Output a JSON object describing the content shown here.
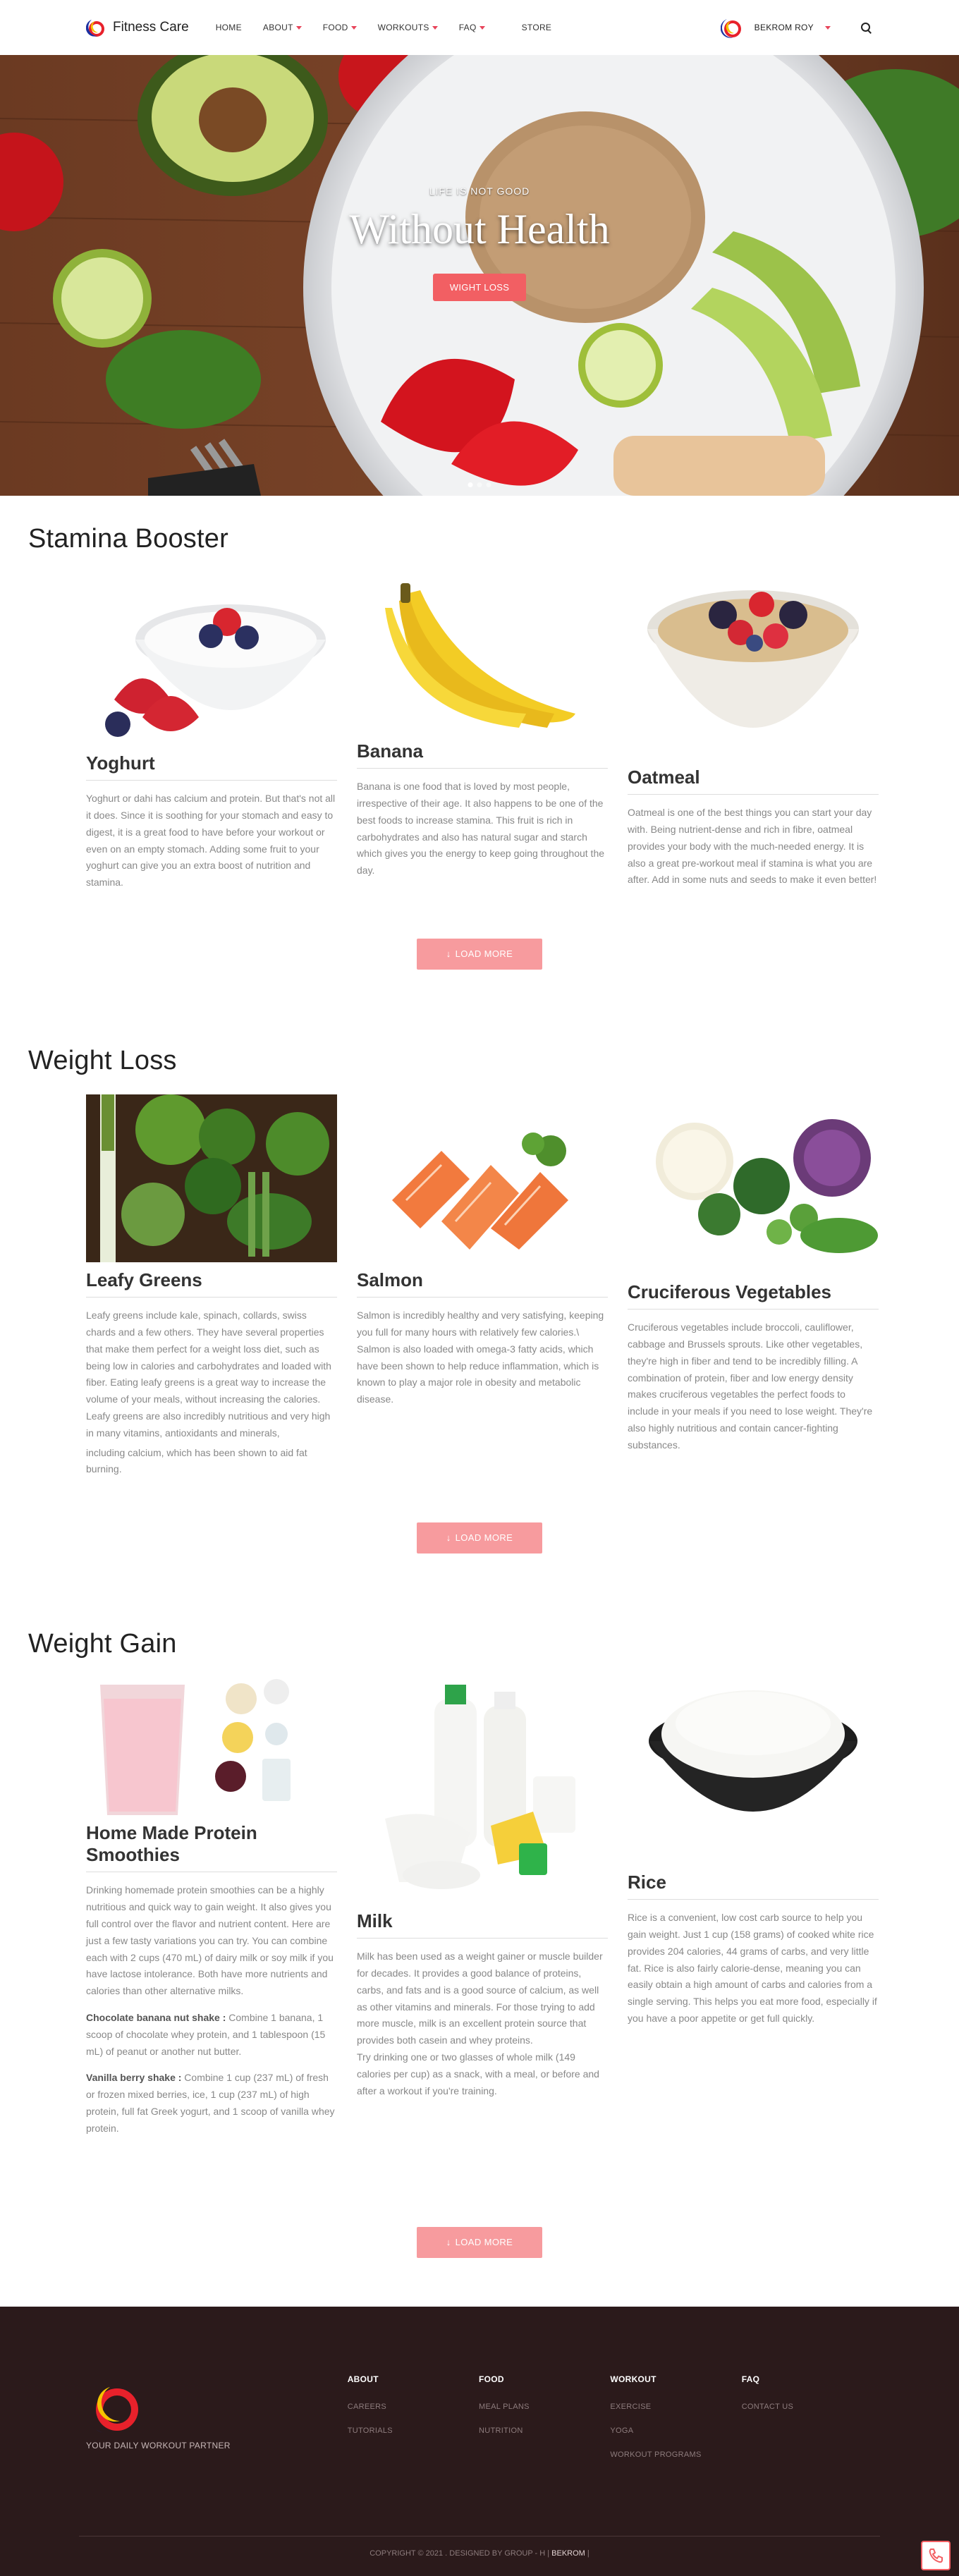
{
  "nav": {
    "brand": "Fitness Care",
    "items": [
      {
        "label": "HOME",
        "caret": false
      },
      {
        "label": "ABOUT",
        "caret": true
      },
      {
        "label": "FOOD",
        "caret": true
      },
      {
        "label": "WORKOUTS",
        "caret": true
      },
      {
        "label": "FAQ",
        "caret": true
      },
      {
        "label": "STORE",
        "caret": false
      }
    ],
    "user": "BEKROM ROY",
    "icons": {
      "search": "search-icon",
      "user": "user-avatar-icon"
    }
  },
  "hero": {
    "kicker": "LIFE IS NOT GOOD",
    "title": "Without Health",
    "button": "WIGHT LOSS"
  },
  "sections": {
    "stamina": {
      "title": "Stamina Booster",
      "load_more": "LOAD MORE",
      "cards": [
        {
          "title": "Yoghurt",
          "text": "Yoghurt or dahi has calcium and protein. But that's not all it does. Since it is soothing for your stomach and easy to digest, it is a great food to have before your workout or even on an empty stomach. Adding some fruit to your yoghurt can give you an extra boost of nutrition and stamina."
        },
        {
          "title": "Banana",
          "text": "Banana is one food that is loved by most people, irrespective of their age. It also happens to be one of the best foods to increase stamina. This fruit is rich in carbohydrates and also has natural sugar and starch which gives you the energy to keep going throughout the day."
        },
        {
          "title": "Oatmeal",
          "text": "Oatmeal is one of the best things you can start your day with. Being nutrient-dense and rich in fibre, oatmeal provides your body with the much-needed energy. It is also a great pre-workout meal if stamina is what you are after. Add in some nuts and seeds to make it even better!"
        }
      ]
    },
    "weight_loss": {
      "title": "Weight Loss",
      "load_more": "LOAD MORE",
      "cards": [
        {
          "title": "Leafy Greens",
          "text": "Leafy greens include kale, spinach, collards, swiss chards and a few others. They have several properties that make them perfect for a weight loss diet, such as being low in calories and carbohydrates and loaded with fiber. Eating leafy greens is a great way to increase the volume of your meals, without increasing the calories. Leafy greens are also incredibly nutritious and very high in many vitamins, antioxidants and minerals,",
          "text2": "including calcium, which has been shown to aid fat burning."
        },
        {
          "title": "Salmon",
          "text": "Salmon is incredibly healthy and very satisfying, keeping you full for many hours with relatively few calories.\\ Salmon is also loaded with omega-3 fatty acids, which have been shown to help reduce inflammation, which is known to play a major role in obesity and metabolic disease."
        },
        {
          "title": "Cruciferous Vegetables",
          "text": "Cruciferous vegetables include broccoli, cauliflower, cabbage and Brussels sprouts. Like other vegetables, they're high in fiber and tend to be incredibly filling. A combination of protein, fiber and low energy density makes cruciferous vegetables the perfect foods to include in your meals if you need to lose weight. They're also highly nutritious and contain cancer-fighting substances."
        }
      ]
    },
    "weight_gain": {
      "title": "Weight Gain",
      "load_more": "LOAD MORE",
      "cards": [
        {
          "title": "Home Made Protein Smoothies",
          "text": "Drinking homemade protein smoothies can be a highly nutritious and quick way to gain weight. It also gives you full control over the flavor and nutrient content. Here are just a few tasty variations you can try. You can combine each with 2 cups (470 mL) of dairy milk or soy milk if you have lactose intolerance. Both have more nutrients and calories than other alternative milks.",
          "recipe1_name": "Chocolate banana nut shake :",
          "recipe1_text": " Combine 1 banana, 1 scoop of chocolate whey protein, and 1 tablespoon (15 mL) of peanut or another nut butter.",
          "recipe2_name": "Vanilla berry shake :",
          "recipe2_text": " Combine 1 cup (237 mL) of fresh or frozen mixed berries, ice, 1 cup (237 mL) of high protein, full fat Greek yogurt, and 1 scoop of vanilla whey protein."
        },
        {
          "title": "Milk",
          "text": "Milk has been used as a weight gainer or muscle builder for decades. It provides a good balance of proteins, carbs, and fats and is a good source of calcium, as well as other vitamins and minerals. For those trying to add more muscle, milk is an excellent protein source that provides both casein and whey proteins.",
          "text2": "Try drinking one or two glasses of whole milk (149 calories per cup) as a snack, with a meal, or before and after a workout if you're training."
        },
        {
          "title": "Rice",
          "text": "Rice is a convenient, low cost carb source to help you gain weight. Just 1 cup (158 grams) of cooked white rice provides 204 calories, 44 grams of carbs, and very little fat. Rice is also fairly calorie-dense, meaning you can easily obtain a high amount of carbs and calories from a single serving. This helps you eat more food, especially if you have a poor appetite or get full quickly."
        }
      ]
    }
  },
  "footer": {
    "tagline": "YOUR DAILY WORKOUT PARTNER",
    "columns": [
      {
        "heading": "ABOUT",
        "links": [
          "CAREERS",
          "TUTORIALS"
        ]
      },
      {
        "heading": "FOOD",
        "links": [
          "MEAL PLANS",
          "NUTRITION"
        ]
      },
      {
        "heading": "WORKOUT",
        "links": [
          "EXERCISE",
          "YOGA",
          "WORKOUT PROGRAMS"
        ]
      },
      {
        "heading": "FAQ",
        "links": [
          "CONTACT US"
        ]
      }
    ],
    "copyright": "COPYRIGHT © 2021 . DESIGNED BY GROUP - H | ",
    "copyright_name": "BEKROM",
    "copyright_end": " |"
  },
  "colors": {
    "accent": "#f25f63",
    "load_more": "#f79b9e",
    "footer_bg": "#2b1a1b"
  }
}
